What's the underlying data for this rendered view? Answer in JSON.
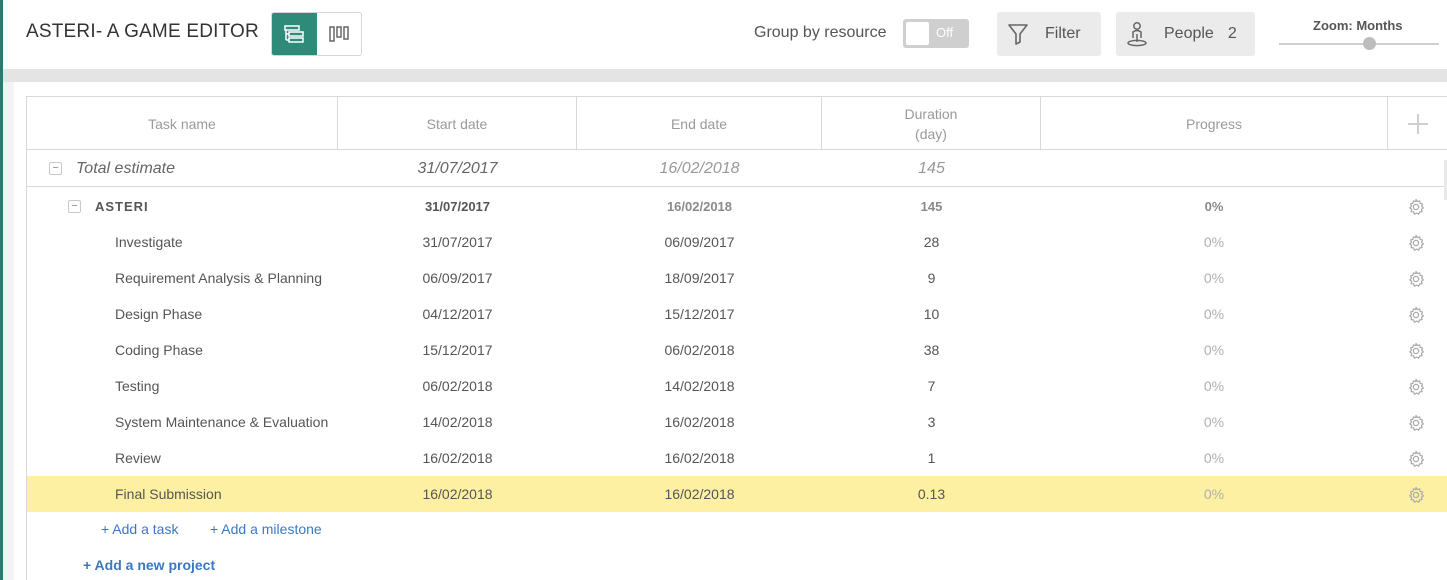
{
  "app": {
    "title": "ASTERI- A GAME EDITOR"
  },
  "toolbar": {
    "group_by_label": "Group by resource",
    "toggle_state": "Off",
    "filter_label": "Filter",
    "people_label": "People",
    "people_count": "2",
    "zoom_label": "Zoom: Months",
    "zoom_level_fraction": 0.56
  },
  "grid": {
    "columns": [
      "Task name",
      "Start date",
      "End date",
      "Duration\n(day)",
      "Progress"
    ],
    "total": {
      "name": "Total estimate",
      "start": "31/07/2017",
      "end": "16/02/2018",
      "duration": "145",
      "progress": ""
    },
    "project": {
      "name": "ASTERI",
      "start": "31/07/2017",
      "end": "16/02/2018",
      "duration": "145",
      "progress": "0%"
    },
    "tasks": [
      {
        "name": "Investigate",
        "start": "31/07/2017",
        "end": "06/09/2017",
        "duration": "28",
        "progress": "0%"
      },
      {
        "name": "Requirement Analysis & Planning",
        "start": "06/09/2017",
        "end": "18/09/2017",
        "duration": "9",
        "progress": "0%"
      },
      {
        "name": "Design Phase",
        "start": "04/12/2017",
        "end": "15/12/2017",
        "duration": "10",
        "progress": "0%"
      },
      {
        "name": "Coding Phase",
        "start": "15/12/2017",
        "end": "06/02/2018",
        "duration": "38",
        "progress": "0%"
      },
      {
        "name": "Testing",
        "start": "06/02/2018",
        "end": "14/02/2018",
        "duration": "7",
        "progress": "0%"
      },
      {
        "name": "System Maintenance & Evaluation",
        "start": "14/02/2018",
        "end": "16/02/2018",
        "duration": "3",
        "progress": "0%"
      },
      {
        "name": "Review",
        "start": "16/02/2018",
        "end": "16/02/2018",
        "duration": "1",
        "progress": "0%"
      },
      {
        "name": "Final Submission",
        "start": "16/02/2018",
        "end": "16/02/2018",
        "duration": "0.13",
        "progress": "0%"
      }
    ],
    "highlighted_task_index": 7,
    "add_task": "+ Add a task",
    "add_milestone": "+ Add a milestone",
    "add_project": "+ Add a new project"
  },
  "colors": {
    "accent": "#2e8b7a",
    "highlight_row": "#fdf0a2",
    "link": "#3b78c2"
  },
  "icons": {
    "list_view": "list-view-icon",
    "board_view": "board-view-icon",
    "filter": "filter-funnel-icon",
    "people": "person-pin-icon",
    "add_column": "plus-icon",
    "row_settings": "gear-icon"
  }
}
